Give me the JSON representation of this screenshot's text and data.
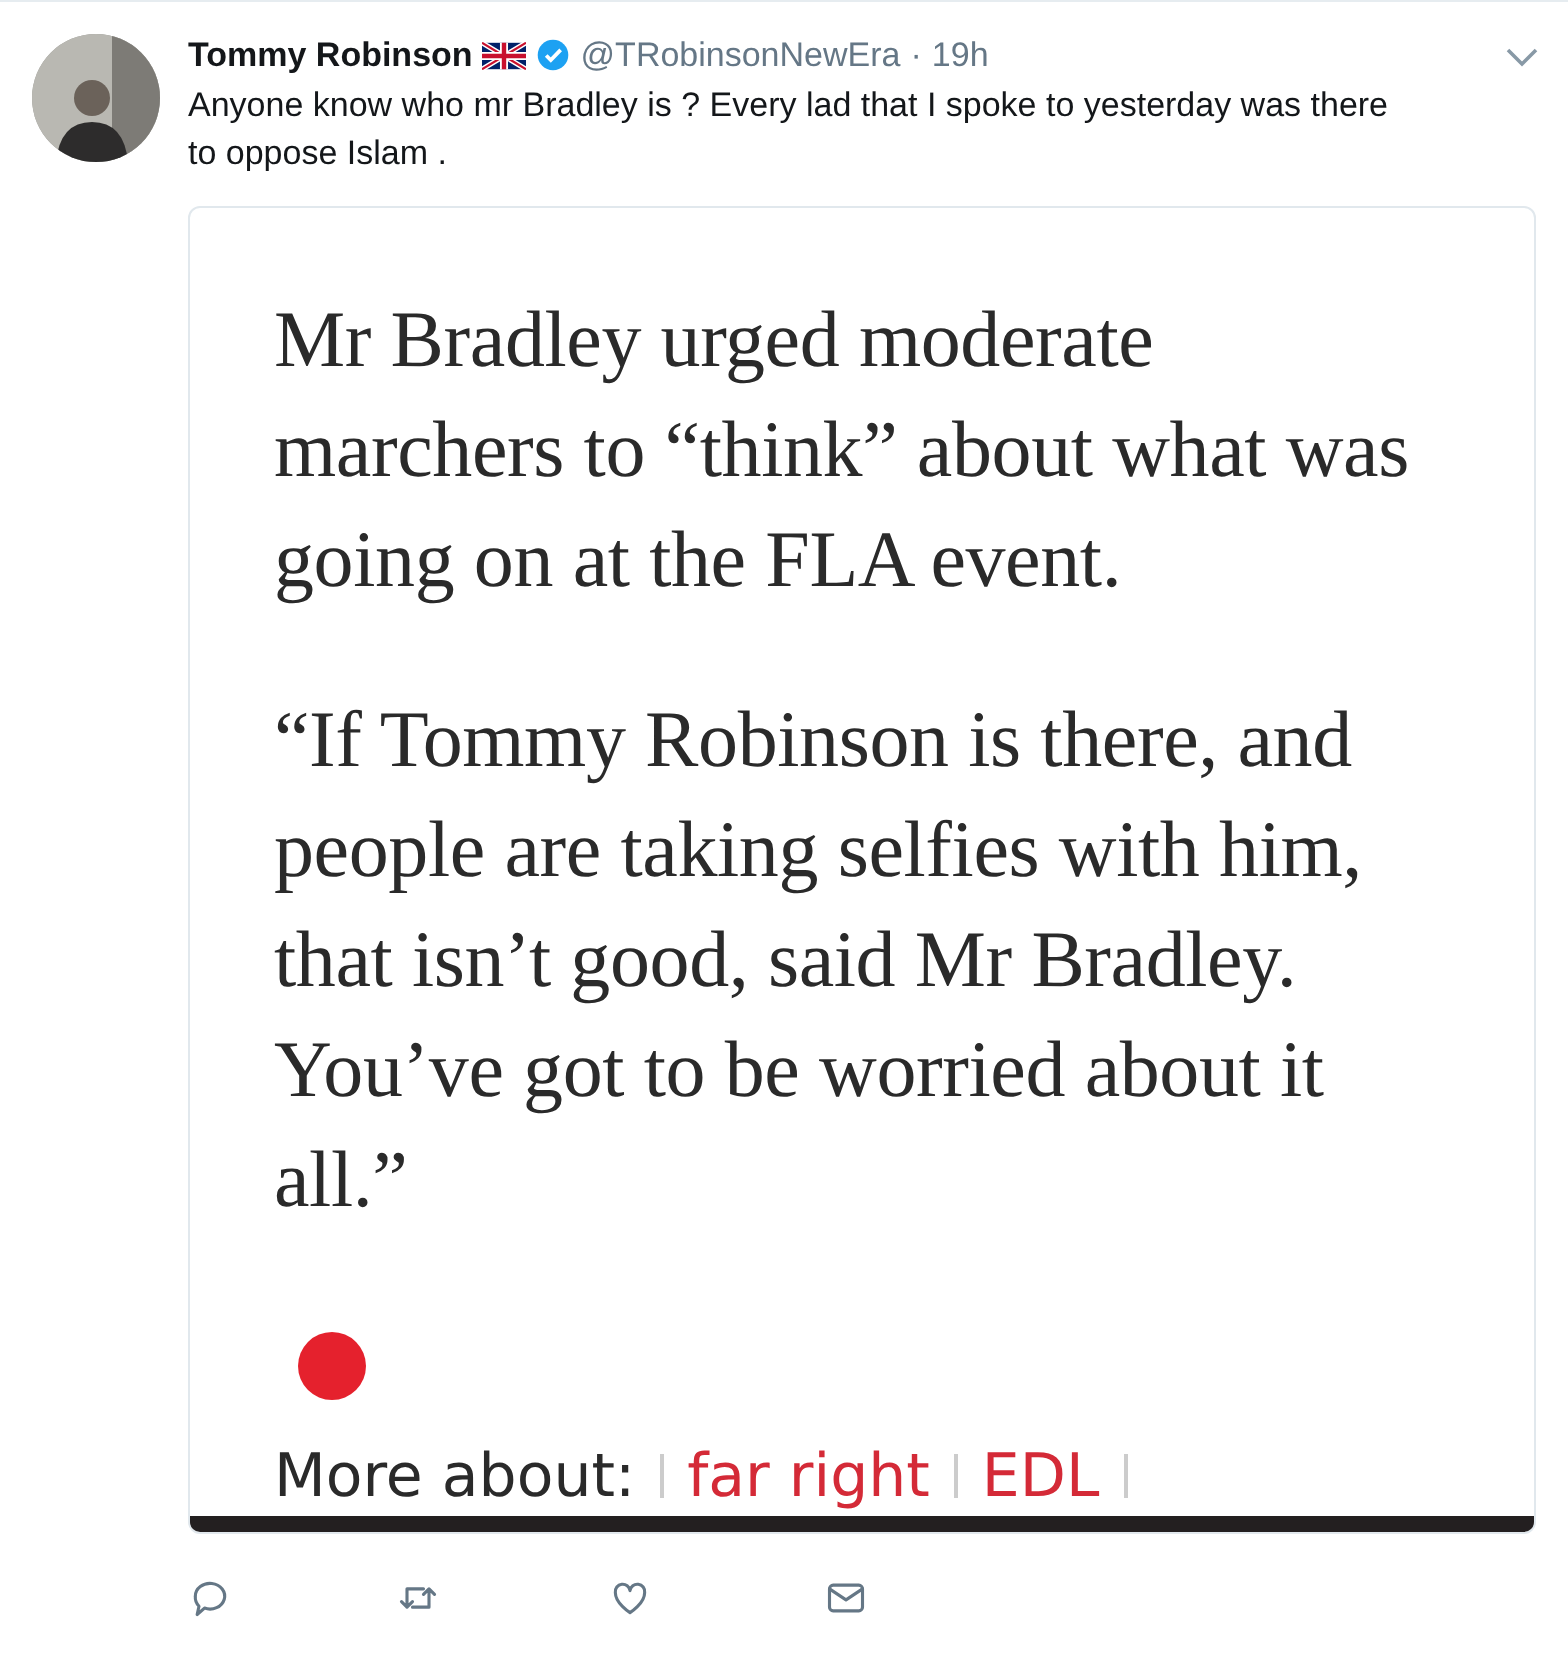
{
  "tweet": {
    "author": "Tommy Robinson",
    "handle": "@TRobinsonNewEra",
    "separator": "·",
    "time": "19h",
    "verified": true,
    "text": "Anyone know who mr Bradley is ? Every lad that I spoke to yesterday was there to oppose Islam .",
    "card": {
      "paragraphs": [
        "Mr Bradley urged moderate marchers to “think” about what was going on at the FLA event.",
        "“If Tommy Robinson is there, and people are taking selfies with him, that isn’t good, said Mr Bradley. You’ve got to be worried about it all.”"
      ],
      "footer_label": "More about:",
      "tags": [
        "far right",
        "EDL"
      ]
    }
  }
}
